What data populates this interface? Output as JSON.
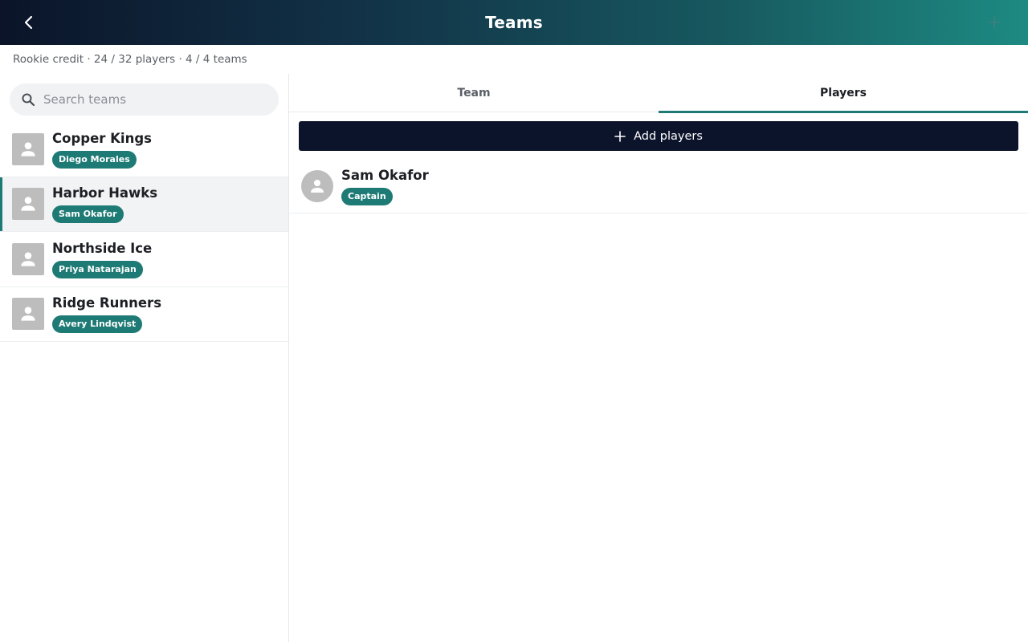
{
  "header": {
    "title": "Teams",
    "back_icon": "chevron-left-icon",
    "add_icon": "plus-icon"
  },
  "subheader": {
    "summary": "Rookie credit · 24 / 32 players · 4 / 4 teams"
  },
  "search": {
    "placeholder": "Search teams",
    "value": ""
  },
  "teams": [
    {
      "name": "Copper Kings",
      "captain": "Diego Morales",
      "selected": false
    },
    {
      "name": "Harbor Hawks",
      "captain": "Sam Okafor",
      "selected": true
    },
    {
      "name": "Northside Ice",
      "captain": "Priya Natarajan",
      "selected": false
    },
    {
      "name": "Ridge Runners",
      "captain": "Avery Lindqvist",
      "selected": false
    }
  ],
  "tabs": [
    {
      "label": "Team",
      "active": false
    },
    {
      "label": "Players",
      "active": true
    }
  ],
  "players_panel": {
    "add_label": "Add players",
    "players": [
      {
        "name": "Sam Okafor",
        "role": "Captain"
      }
    ]
  },
  "colors": {
    "accent": "#1e7a75",
    "header_dark": "#0b1429",
    "header_light": "#1d8a82",
    "button_dark": "#0c142b"
  }
}
